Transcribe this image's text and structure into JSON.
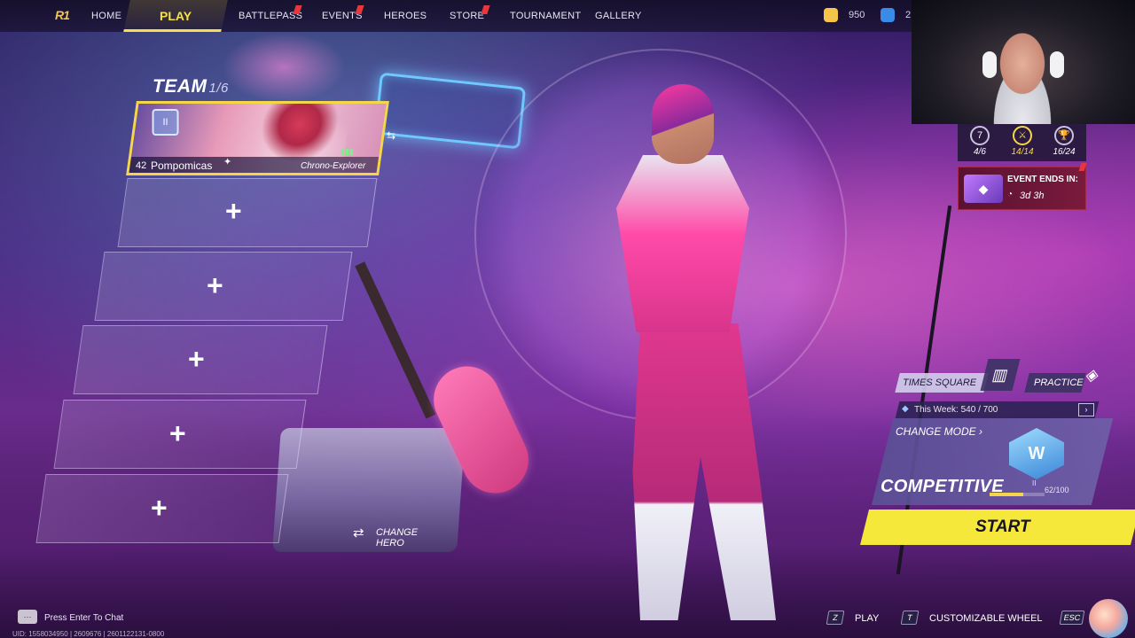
{
  "nav": {
    "home": "HOME",
    "play": "PLAY",
    "battlepass": "BATTLEPASS",
    "events": "EVENTS",
    "heroes": "HEROES",
    "store": "STORE",
    "tournament": "TOURNAMENT",
    "gallery": "GALLERY",
    "currency_1": "950",
    "currency_2": "2"
  },
  "team": {
    "title": "TEAM",
    "count": "1/6",
    "member": {
      "level": "42",
      "name": "Pompomicas",
      "title": "Chrono-Explorer"
    },
    "empty_slot_plus": "+"
  },
  "change_hero": {
    "icon": "⇄",
    "label": "CHANGE HERO"
  },
  "stats": [
    {
      "icon": "7",
      "value": "4/6"
    },
    {
      "icon": "⚔",
      "value": "14/14"
    },
    {
      "icon": "🏆",
      "value": "16/24"
    }
  ],
  "event": {
    "label": "EVENT ENDS IN:",
    "time": "3d 3h"
  },
  "mode": {
    "map_tab": "TIMES SQUARE",
    "practice_tab": "PRACTICE",
    "week_label": "This Week:",
    "week_value": "540",
    "week_max": "/ 700",
    "change_mode": "CHANGE MODE",
    "name": "COMPETITIVE",
    "emblem_tier": "II",
    "progress_label": "62/100",
    "progress_fraction": 0.62
  },
  "start": {
    "label": "START"
  },
  "bottom": {
    "chat_hint": "Press Enter To Chat",
    "uid": "UID: 1558034950 | 2609676 | 2601122131-0800",
    "play_key": "Z",
    "play_label": "PLAY",
    "wheel_key": "T",
    "wheel_label": "CUSTOMIZABLE WHEEL",
    "esc_key": "ESC"
  },
  "colors": {
    "accent_yellow": "#f5e83a",
    "highlight_gold": "#f5d64a",
    "alert_red": "#e8363a",
    "event_bg": "#7a1a3c"
  }
}
